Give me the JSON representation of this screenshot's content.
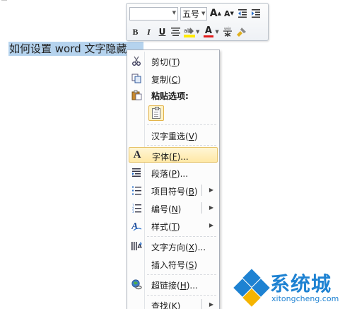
{
  "document": {
    "selected_text": "如何设置 word 文字隐藏"
  },
  "mini_toolbar": {
    "font_name": "",
    "font_size": "五号",
    "grow_font": "A",
    "shrink_font": "A",
    "bold": "B",
    "italic": "I",
    "underline": "U",
    "font_color_letter": "A"
  },
  "context_menu": {
    "items": [
      {
        "label": "剪切(",
        "key": "T",
        "tail": ")",
        "icon": "scissors-icon"
      },
      {
        "label": "复制(",
        "key": "C",
        "tail": ")",
        "icon": "copy-icon"
      },
      {
        "label": "粘贴选项:",
        "key": "",
        "tail": "",
        "icon": "paste-icon"
      },
      {
        "label": "汉字重选(",
        "key": "V",
        "tail": ")",
        "icon": ""
      },
      {
        "label": "字体(",
        "key": "F",
        "tail": ")...",
        "icon": "font-icon"
      },
      {
        "label": "段落(",
        "key": "P",
        "tail": ")...",
        "icon": "paragraph-icon"
      },
      {
        "label": "项目符号(",
        "key": "B",
        "tail": ")",
        "icon": "bullets-icon"
      },
      {
        "label": "编号(",
        "key": "N",
        "tail": ")",
        "icon": "numbering-icon"
      },
      {
        "label": "样式(",
        "key": "T",
        "tail": ")",
        "icon": "styles-icon"
      },
      {
        "label": "文字方向(",
        "key": "X",
        "tail": ")...",
        "icon": "text-direction-icon"
      },
      {
        "label": "插入符号(",
        "key": "S",
        "tail": ")",
        "icon": ""
      },
      {
        "label": "超链接(",
        "key": "H",
        "tail": ")...",
        "icon": "hyperlink-icon"
      },
      {
        "label": "查找(",
        "key": "K",
        "tail": ")",
        "icon": ""
      }
    ]
  },
  "watermark": {
    "brand": "系统城",
    "url": "xitongcheng.com"
  },
  "colors": {
    "selection": "#b5d3ee",
    "menu_hover": "#ffe8a6",
    "watermark_blue": "#1e82d2"
  }
}
